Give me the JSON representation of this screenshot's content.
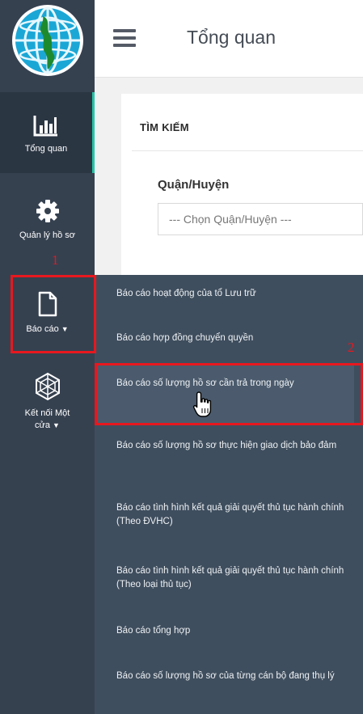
{
  "header": {
    "title": "Tổng quan"
  },
  "sidebar": {
    "items": [
      {
        "label": "Tổng quan",
        "icon": "bar-chart-icon"
      },
      {
        "label": "Quản lý hồ sơ",
        "icon": "gear-icon"
      },
      {
        "label": "Báo cáo",
        "icon": "document-icon"
      },
      {
        "label_line1": "Kết nối Một",
        "label_line2": "cửa",
        "icon": "network-icon"
      }
    ]
  },
  "search_panel": {
    "title": "TÌM KIẾM",
    "district_label": "Quận/Huyện",
    "district_select": "--- Chọn Quận/Huyện ---"
  },
  "report_menu": {
    "items": [
      "Báo cáo hoạt động của tổ Lưu trữ",
      "Báo cáo hợp đồng chuyển quyền",
      "Báo cáo số lượng hồ sơ cần trả trong ngày",
      "Báo cáo số lượng hồ sơ thực hiện giao dịch bảo đảm",
      "Báo cáo tình hình kết quả giải quyết thủ tục hành chính (Theo ĐVHC)",
      "Báo cáo tình hình kết quả giải quyết thủ tục hành chính (Theo loại thủ tục)",
      "Báo cáo tổng hợp",
      "Báo cáo số lượng hồ sơ của từng cán bộ đang thụ lý"
    ]
  },
  "annotations": {
    "step1": "1",
    "step2": "2"
  },
  "colors": {
    "sidebar": "#364150",
    "submenu": "#3f4e5e",
    "accent": "#26c6a8",
    "annotation": "#e8171e"
  }
}
